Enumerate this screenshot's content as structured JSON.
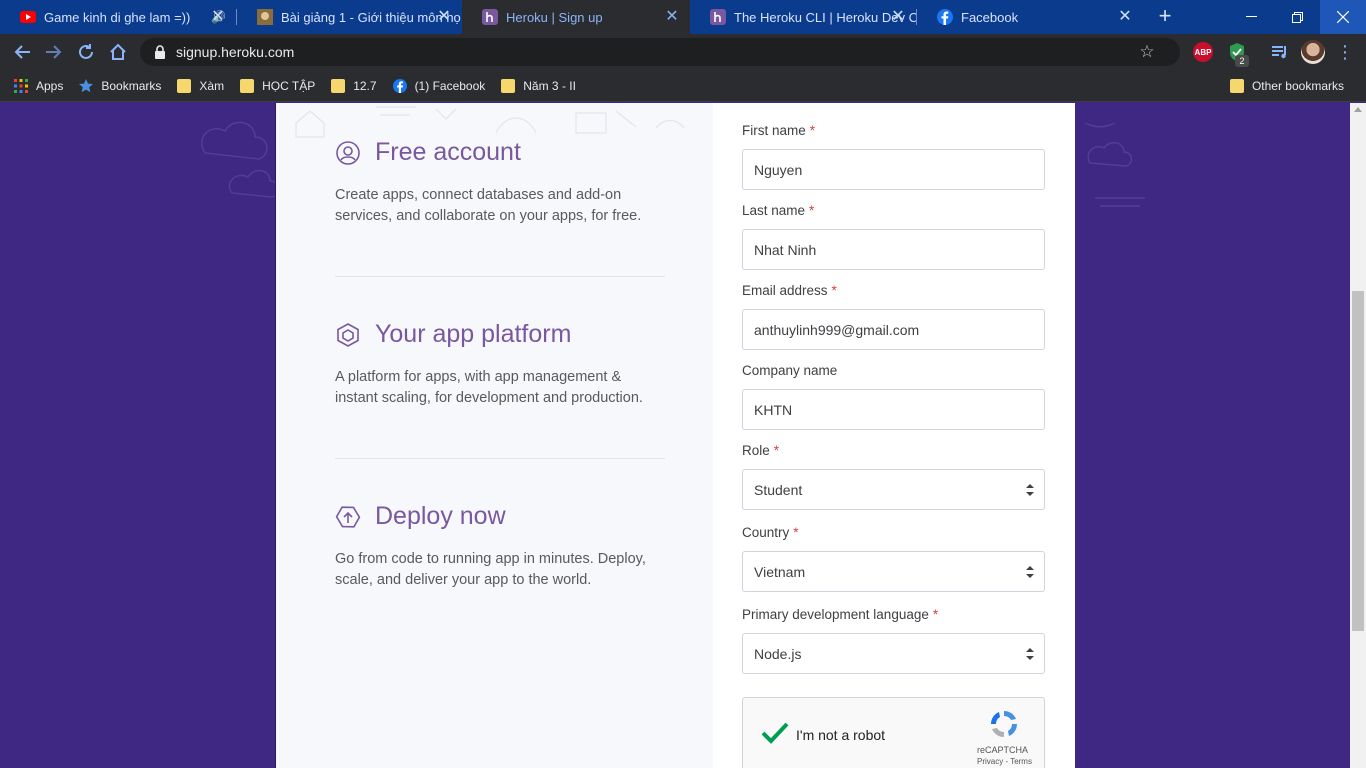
{
  "browser": {
    "tabs": [
      {
        "title": "Game kinh di ghe lam =))",
        "favicon": "youtube-icon",
        "audio": true,
        "active": false
      },
      {
        "title": "Bài giảng 1 - Giới thiệu môn họ",
        "favicon": "course-icon",
        "active": false
      },
      {
        "title": "Heroku | Sign up",
        "favicon": "heroku-icon",
        "active": true
      },
      {
        "title": "The Heroku CLI | Heroku Dev C",
        "favicon": "heroku-icon",
        "active": false
      },
      {
        "title": "Facebook",
        "favicon": "facebook-icon",
        "active": false
      }
    ],
    "url": "signup.heroku.com",
    "extensions": {
      "abp_label": "ABP",
      "shield_badge": "2"
    },
    "bookmarks": [
      {
        "label": "Apps",
        "icon": "apps-grid-icon"
      },
      {
        "label": "Bookmarks",
        "icon": "star-icon"
      },
      {
        "label": "Xàm",
        "icon": "folder-icon"
      },
      {
        "label": "HỌC TẬP",
        "icon": "folder-icon"
      },
      {
        "label": "12.7",
        "icon": "folder-icon"
      },
      {
        "label": "(1) Facebook",
        "icon": "facebook-icon"
      },
      {
        "label": "Năm 3 - II",
        "icon": "folder-icon"
      }
    ],
    "other_bookmarks": "Other bookmarks"
  },
  "features": [
    {
      "title": "Free account",
      "icon": "user-circle-icon",
      "description": "Create apps, connect databases and add-on services, and collaborate on your apps, for free."
    },
    {
      "title": "Your app platform",
      "icon": "hexagon-icon",
      "description": "A platform for apps, with app management & instant scaling, for development and production."
    },
    {
      "title": "Deploy now",
      "icon": "upload-icon",
      "description": "Go from code to running app in minutes. Deploy, scale, and deliver your app to the world."
    }
  ],
  "form": {
    "first_name": {
      "label": "First name",
      "required": "*",
      "value": "Nguyen"
    },
    "last_name": {
      "label": "Last name",
      "required": "*",
      "value": "Nhat Ninh"
    },
    "email": {
      "label": "Email address",
      "required": "*",
      "value": "anthuylinh999@gmail.com"
    },
    "company": {
      "label": "Company name",
      "value": "KHTN"
    },
    "role": {
      "label": "Role",
      "required": "*",
      "value": "Student"
    },
    "country": {
      "label": "Country",
      "required": "*",
      "value": "Vietnam"
    },
    "language": {
      "label": "Primary development language",
      "required": "*",
      "value": "Node.js"
    },
    "captcha": {
      "label": "I'm not a robot",
      "brand": "reCAPTCHA",
      "terms": "Privacy - Terms"
    }
  },
  "colors": {
    "brand_purple": "#79589f",
    "page_bg": "#3f2883",
    "checkmark": "#009e55",
    "required": "#d64040"
  }
}
